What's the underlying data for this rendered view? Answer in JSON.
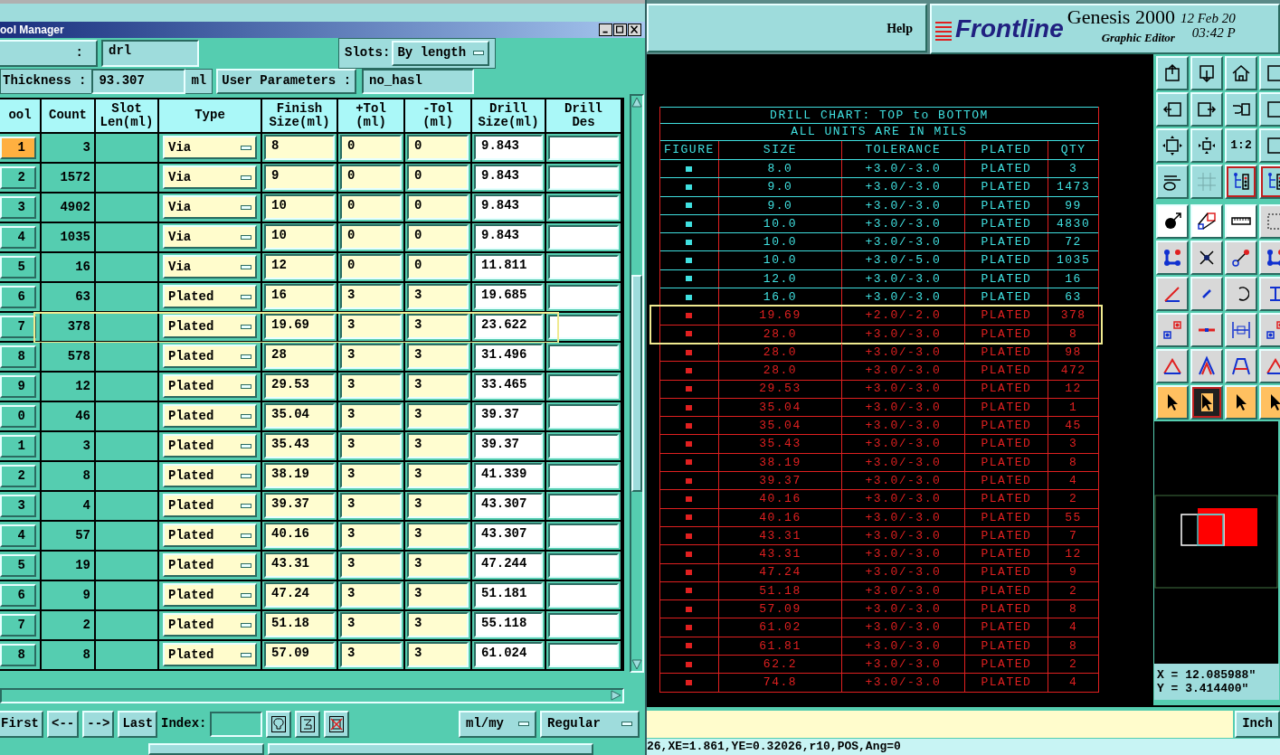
{
  "tool_manager": {
    "title": "ool Manager",
    "job_label": ":",
    "job_value": "drl",
    "slots_label": "Slots:",
    "slots_value": "By length",
    "thickness_label": "Thickness :",
    "thickness_value": "93.307",
    "thickness_unit": "ml",
    "user_params_button": "User Parameters :",
    "user_params_value": "no_hasl",
    "columns": [
      [
        "ool"
      ],
      [
        "Count"
      ],
      [
        "Slot",
        "Len(ml)"
      ],
      [
        "Type"
      ],
      [
        "Finish",
        "Size(ml)"
      ],
      [
        "+Tol",
        "(ml)"
      ],
      [
        "-Tol",
        "(ml)"
      ],
      [
        "Drill",
        "Size(ml)"
      ],
      [
        "Drill",
        "Des"
      ]
    ],
    "rows": [
      {
        "tool": "1",
        "selected": true,
        "highlighted": false,
        "count": "3",
        "type": "Via",
        "finish": "8",
        "plus_tol": "0",
        "minus_tol": "0",
        "drill_size": "9.843"
      },
      {
        "tool": "2",
        "selected": false,
        "highlighted": false,
        "count": "1572",
        "type": "Via",
        "finish": "9",
        "plus_tol": "0",
        "minus_tol": "0",
        "drill_size": "9.843"
      },
      {
        "tool": "3",
        "selected": false,
        "highlighted": false,
        "count": "4902",
        "type": "Via",
        "finish": "10",
        "plus_tol": "0",
        "minus_tol": "0",
        "drill_size": "9.843"
      },
      {
        "tool": "4",
        "selected": false,
        "highlighted": false,
        "count": "1035",
        "type": "Via",
        "finish": "10",
        "plus_tol": "0",
        "minus_tol": "0",
        "drill_size": "9.843"
      },
      {
        "tool": "5",
        "selected": false,
        "highlighted": false,
        "count": "16",
        "type": "Via",
        "finish": "12",
        "plus_tol": "0",
        "minus_tol": "0",
        "drill_size": "11.811"
      },
      {
        "tool": "6",
        "selected": false,
        "highlighted": false,
        "count": "63",
        "type": "Plated",
        "finish": "16",
        "plus_tol": "3",
        "minus_tol": "3",
        "drill_size": "19.685"
      },
      {
        "tool": "7",
        "selected": false,
        "highlighted": true,
        "count": "378",
        "type": "Plated",
        "finish": "19.69",
        "plus_tol": "3",
        "minus_tol": "3",
        "drill_size": "23.622"
      },
      {
        "tool": "8",
        "selected": false,
        "highlighted": false,
        "count": "578",
        "type": "Plated",
        "finish": "28",
        "plus_tol": "3",
        "minus_tol": "3",
        "drill_size": "31.496"
      },
      {
        "tool": "9",
        "selected": false,
        "highlighted": false,
        "count": "12",
        "type": "Plated",
        "finish": "29.53",
        "plus_tol": "3",
        "minus_tol": "3",
        "drill_size": "33.465"
      },
      {
        "tool": "0",
        "selected": false,
        "highlighted": false,
        "count": "46",
        "type": "Plated",
        "finish": "35.04",
        "plus_tol": "3",
        "minus_tol": "3",
        "drill_size": "39.37"
      },
      {
        "tool": "1",
        "selected": false,
        "highlighted": false,
        "count": "3",
        "type": "Plated",
        "finish": "35.43",
        "plus_tol": "3",
        "minus_tol": "3",
        "drill_size": "39.37"
      },
      {
        "tool": "2",
        "selected": false,
        "highlighted": false,
        "count": "8",
        "type": "Plated",
        "finish": "38.19",
        "plus_tol": "3",
        "minus_tol": "3",
        "drill_size": "41.339"
      },
      {
        "tool": "3",
        "selected": false,
        "highlighted": false,
        "count": "4",
        "type": "Plated",
        "finish": "39.37",
        "plus_tol": "3",
        "minus_tol": "3",
        "drill_size": "43.307"
      },
      {
        "tool": "4",
        "selected": false,
        "highlighted": false,
        "count": "57",
        "type": "Plated",
        "finish": "40.16",
        "plus_tol": "3",
        "minus_tol": "3",
        "drill_size": "43.307"
      },
      {
        "tool": "5",
        "selected": false,
        "highlighted": false,
        "count": "19",
        "type": "Plated",
        "finish": "43.31",
        "plus_tol": "3",
        "minus_tol": "3",
        "drill_size": "47.244"
      },
      {
        "tool": "6",
        "selected": false,
        "highlighted": false,
        "count": "9",
        "type": "Plated",
        "finish": "47.24",
        "plus_tol": "3",
        "minus_tol": "3",
        "drill_size": "51.181"
      },
      {
        "tool": "7",
        "selected": false,
        "highlighted": false,
        "count": "2",
        "type": "Plated",
        "finish": "51.18",
        "plus_tol": "3",
        "minus_tol": "3",
        "drill_size": "55.118"
      },
      {
        "tool": "8",
        "selected": false,
        "highlighted": false,
        "count": "8",
        "type": "Plated",
        "finish": "57.09",
        "plus_tol": "3",
        "minus_tol": "3",
        "drill_size": "61.024"
      }
    ],
    "nav_buttons": [
      "First",
      "<--",
      "-->",
      "Last"
    ],
    "index_label": "Index:",
    "units_value": "ml/my",
    "mode_value": "Regular"
  },
  "editor": {
    "help": "Help",
    "logo": "Frontline",
    "product": "Genesis 2000",
    "subtitle": "Graphic Editor",
    "date": "12 Feb 20",
    "time": "03:42 P",
    "zoom_ratio": "1:2",
    "drill_chart": {
      "title": "DRILL CHART: TOP to BOTTOM",
      "subtitle": "ALL UNITS ARE IN MILS",
      "columns": [
        "FIGURE",
        "SIZE",
        "TOLERANCE",
        "PLATED",
        "QTY"
      ],
      "rows": [
        {
          "size": "8.0",
          "tolerance": "+3.0/-3.0",
          "plated": "PLATED",
          "qty": "3",
          "color": "#40e0e0",
          "highlighted": false
        },
        {
          "size": "9.0",
          "tolerance": "+3.0/-3.0",
          "plated": "PLATED",
          "qty": "1473",
          "color": "#40e0e0",
          "highlighted": false
        },
        {
          "size": "9.0",
          "tolerance": "+3.0/-3.0",
          "plated": "PLATED",
          "qty": "99",
          "color": "#40e0e0",
          "highlighted": false
        },
        {
          "size": "10.0",
          "tolerance": "+3.0/-3.0",
          "plated": "PLATED",
          "qty": "4830",
          "color": "#40e0e0",
          "highlighted": false
        },
        {
          "size": "10.0",
          "tolerance": "+3.0/-3.0",
          "plated": "PLATED",
          "qty": "72",
          "color": "#40e0e0",
          "highlighted": false
        },
        {
          "size": "10.0",
          "tolerance": "+3.0/-5.0",
          "plated": "PLATED",
          "qty": "1035",
          "color": "#40e0e0",
          "highlighted": false
        },
        {
          "size": "12.0",
          "tolerance": "+3.0/-3.0",
          "plated": "PLATED",
          "qty": "16",
          "color": "#40e0e0",
          "highlighted": false
        },
        {
          "size": "16.0",
          "tolerance": "+3.0/-3.0",
          "plated": "PLATED",
          "qty": "63",
          "color": "#40e0e0",
          "highlighted": false
        },
        {
          "size": "19.69",
          "tolerance": "+2.0/-2.0",
          "plated": "PLATED",
          "qty": "378",
          "color": "#e02020",
          "highlighted": true
        },
        {
          "size": "28.0",
          "tolerance": "+3.0/-3.0",
          "plated": "PLATED",
          "qty": "8",
          "color": "#e02020",
          "highlighted": true
        },
        {
          "size": "28.0",
          "tolerance": "+3.0/-3.0",
          "plated": "PLATED",
          "qty": "98",
          "color": "#e02020",
          "highlighted": false
        },
        {
          "size": "28.0",
          "tolerance": "+3.0/-3.0",
          "plated": "PLATED",
          "qty": "472",
          "color": "#e02020",
          "highlighted": false
        },
        {
          "size": "29.53",
          "tolerance": "+3.0/-3.0",
          "plated": "PLATED",
          "qty": "12",
          "color": "#e02020",
          "highlighted": false
        },
        {
          "size": "35.04",
          "tolerance": "+3.0/-3.0",
          "plated": "PLATED",
          "qty": "1",
          "color": "#e02020",
          "highlighted": false
        },
        {
          "size": "35.04",
          "tolerance": "+3.0/-3.0",
          "plated": "PLATED",
          "qty": "45",
          "color": "#e02020",
          "highlighted": false
        },
        {
          "size": "35.43",
          "tolerance": "+3.0/-3.0",
          "plated": "PLATED",
          "qty": "3",
          "color": "#e02020",
          "highlighted": false
        },
        {
          "size": "38.19",
          "tolerance": "+3.0/-3.0",
          "plated": "PLATED",
          "qty": "8",
          "color": "#e02020",
          "highlighted": false
        },
        {
          "size": "39.37",
          "tolerance": "+3.0/-3.0",
          "plated": "PLATED",
          "qty": "4",
          "color": "#e02020",
          "highlighted": false
        },
        {
          "size": "40.16",
          "tolerance": "+3.0/-3.0",
          "plated": "PLATED",
          "qty": "2",
          "color": "#e02020",
          "highlighted": false
        },
        {
          "size": "40.16",
          "tolerance": "+3.0/-3.0",
          "plated": "PLATED",
          "qty": "55",
          "color": "#e02020",
          "highlighted": false
        },
        {
          "size": "43.31",
          "tolerance": "+3.0/-3.0",
          "plated": "PLATED",
          "qty": "7",
          "color": "#e02020",
          "highlighted": false
        },
        {
          "size": "43.31",
          "tolerance": "+3.0/-3.0",
          "plated": "PLATED",
          "qty": "12",
          "color": "#e02020",
          "highlighted": false
        },
        {
          "size": "47.24",
          "tolerance": "+3.0/-3.0",
          "plated": "PLATED",
          "qty": "9",
          "color": "#e02020",
          "highlighted": false
        },
        {
          "size": "51.18",
          "tolerance": "+3.0/-3.0",
          "plated": "PLATED",
          "qty": "2",
          "color": "#e02020",
          "highlighted": false
        },
        {
          "size": "57.09",
          "tolerance": "+3.0/-3.0",
          "plated": "PLATED",
          "qty": "8",
          "color": "#e02020",
          "highlighted": false
        },
        {
          "size": "61.02",
          "tolerance": "+3.0/-3.0",
          "plated": "PLATED",
          "qty": "4",
          "color": "#e02020",
          "highlighted": false
        },
        {
          "size": "61.81",
          "tolerance": "+3.0/-3.0",
          "plated": "PLATED",
          "qty": "8",
          "color": "#e02020",
          "highlighted": false
        },
        {
          "size": "62.2",
          "tolerance": "+3.0/-3.0",
          "plated": "PLATED",
          "qty": "2",
          "color": "#e02020",
          "highlighted": false
        },
        {
          "size": "74.8",
          "tolerance": "+3.0/-3.0",
          "plated": "PLATED",
          "qty": "4",
          "color": "#e02020",
          "highlighted": false
        }
      ]
    },
    "coord_x": "X = 12.085988\"",
    "coord_y": "Y = 3.414400\"",
    "units_button": "Inch",
    "status": "26,XE=1.861,YE=0.32026,r10,POS,Ang=0"
  }
}
